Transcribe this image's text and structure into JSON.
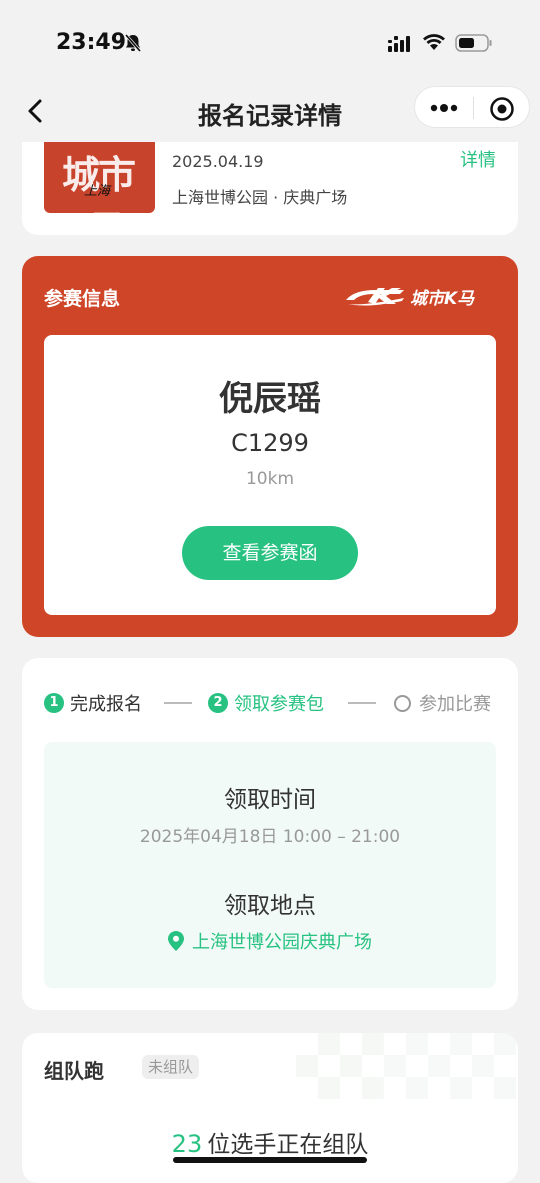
{
  "status_bar": {
    "time": "23:49"
  },
  "nav": {
    "title": "报名记录详情"
  },
  "event": {
    "thumb_text": "城市K马",
    "thumb_sub": "上海",
    "date": "2025.04.19",
    "venue": "上海世博公园 · 庆典广场",
    "detail_link": "详情"
  },
  "info": {
    "title": "参赛信息",
    "brand": "城市K马",
    "runner_name": "倪辰瑶",
    "bib_number": "C1299",
    "distance": "10km",
    "letter_button": "查看参赛函"
  },
  "pickup": {
    "steps": [
      {
        "num": "1",
        "label": "完成报名",
        "state": "done"
      },
      {
        "num": "2",
        "label": "领取参赛包",
        "state": "active"
      },
      {
        "num": "",
        "label": "参加比赛",
        "state": "pending"
      }
    ],
    "time_label": "领取时间",
    "time_value": "2025年04月18日 10:00 – 21:00",
    "place_label": "领取地点",
    "place_value": "上海世博公园庆典广场"
  },
  "team": {
    "title": "组队跑",
    "badge": "未组队",
    "count": "23",
    "count_text": "位选手正在组队"
  },
  "colors": {
    "accent_green": "#27c281",
    "brand_red": "#cf4528"
  }
}
